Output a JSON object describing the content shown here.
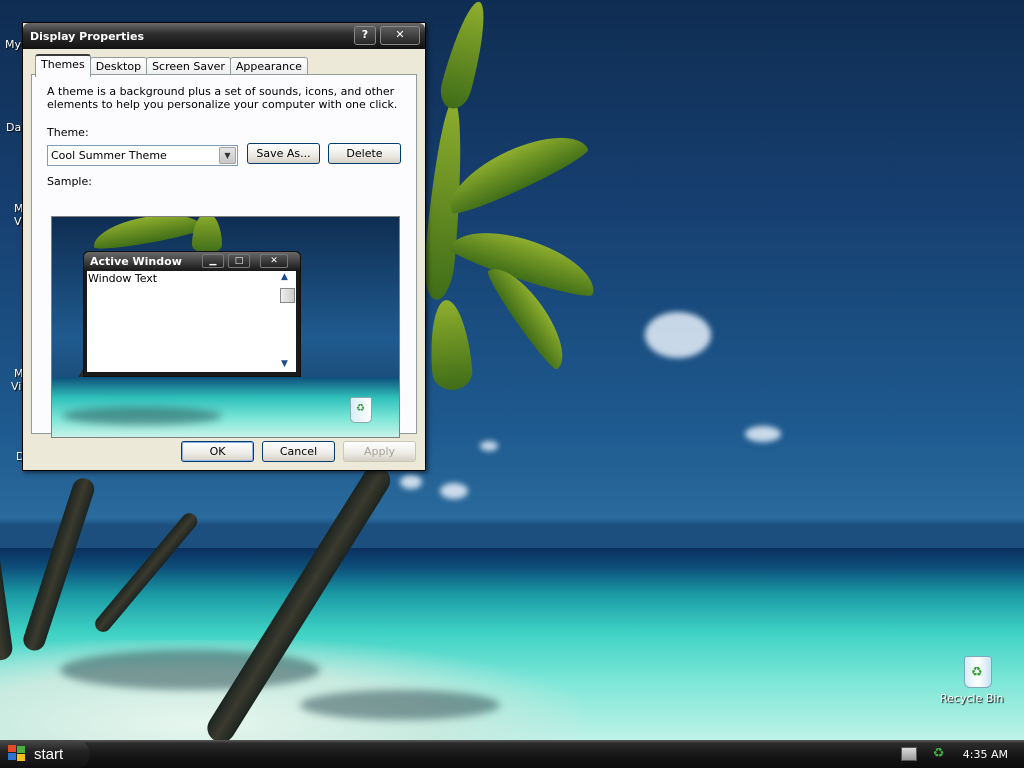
{
  "dialog": {
    "title": "Display Properties",
    "help_button": "?",
    "close_button": "✕",
    "tabs": [
      {
        "label": "Themes",
        "active": true
      },
      {
        "label": "Desktop",
        "active": false
      },
      {
        "label": "Screen Saver",
        "active": false
      },
      {
        "label": "Appearance",
        "active": false
      }
    ],
    "themes_tab": {
      "description": "A theme is a background plus a set of sounds, icons, and other elements to help you personalize your computer with one click.",
      "theme_label": "Theme:",
      "theme_selected": "Cool Summer Theme",
      "save_as_label": "Save As...",
      "delete_label": "Delete",
      "sample_label": "Sample:"
    },
    "sample": {
      "active_window_title": "Active Window",
      "window_text": "Window Text"
    },
    "buttons": {
      "ok": "OK",
      "cancel": "Cancel",
      "apply": "Apply",
      "apply_enabled": false
    }
  },
  "desktop": {
    "partial_icon_labels": [
      "My",
      "Da",
      "M",
      "V",
      "M",
      "Vi",
      "D"
    ],
    "recycle_bin_label": "Recycle Bin"
  },
  "taskbar": {
    "start_label": "start",
    "clock": "4:35 AM"
  }
}
